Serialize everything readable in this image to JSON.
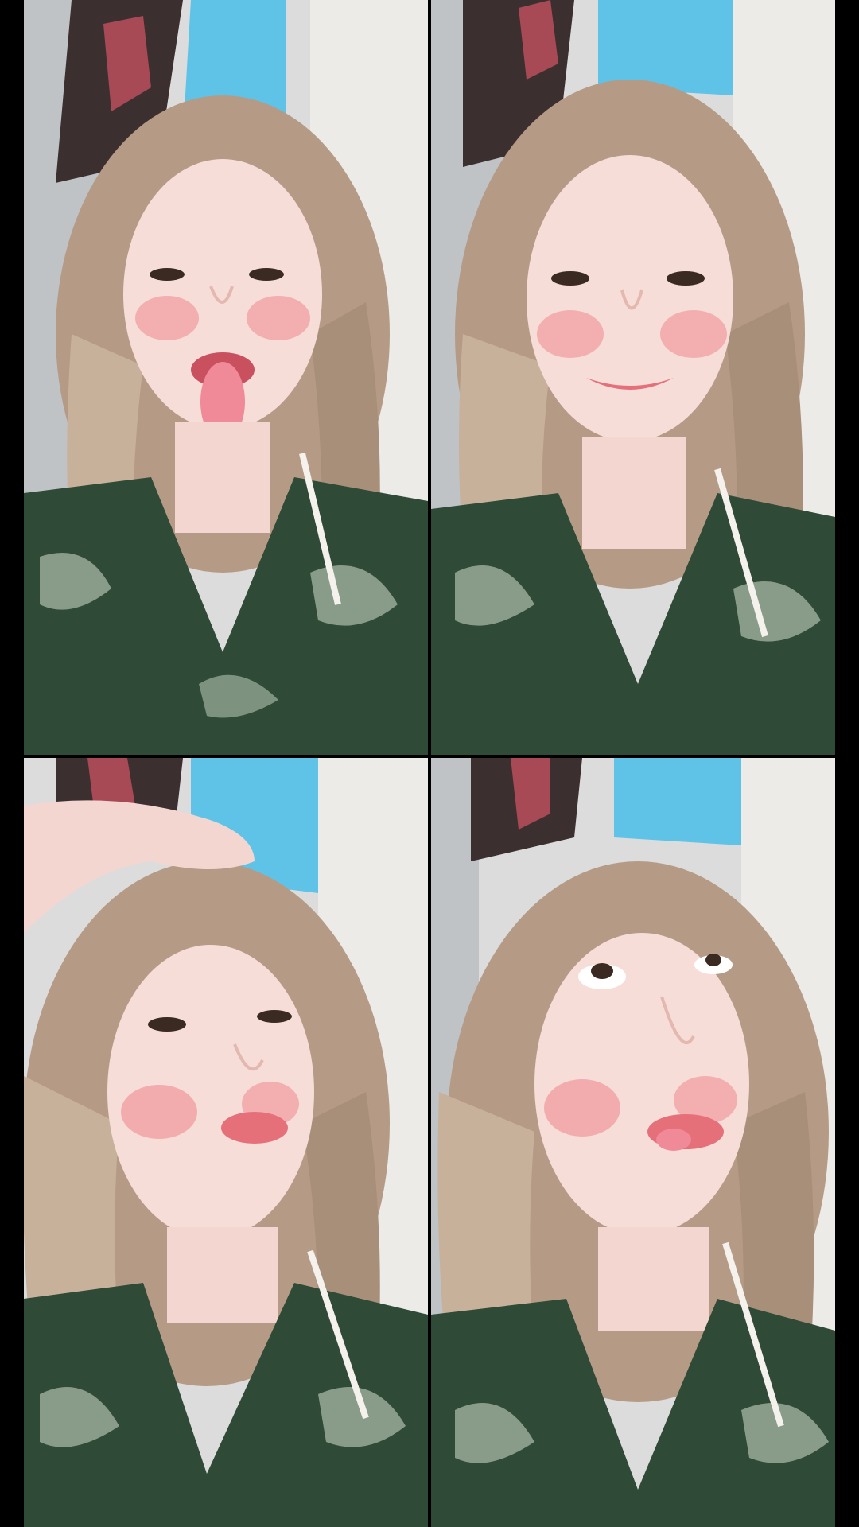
{
  "panels": [
    {
      "id": "top-left",
      "expression": "tongue-out"
    },
    {
      "id": "top-right",
      "expression": "smile"
    },
    {
      "id": "bottom-left",
      "expression": "hand-on-head"
    },
    {
      "id": "bottom-right",
      "expression": "eyes-up-tongue"
    }
  ],
  "colors": {
    "background": "#000000",
    "wall": "#ecebe8",
    "wall_shadow": "#cfd2d4",
    "sky_blue": "#5fc3e8",
    "hair": "#b59b85",
    "hair_light": "#d9c6b3",
    "skin": "#f6ddd8",
    "blush": "#f2a3a6",
    "lips": "#e5707a",
    "shirt": "#2f4a36",
    "shirt_pattern": "#9fb09f"
  }
}
